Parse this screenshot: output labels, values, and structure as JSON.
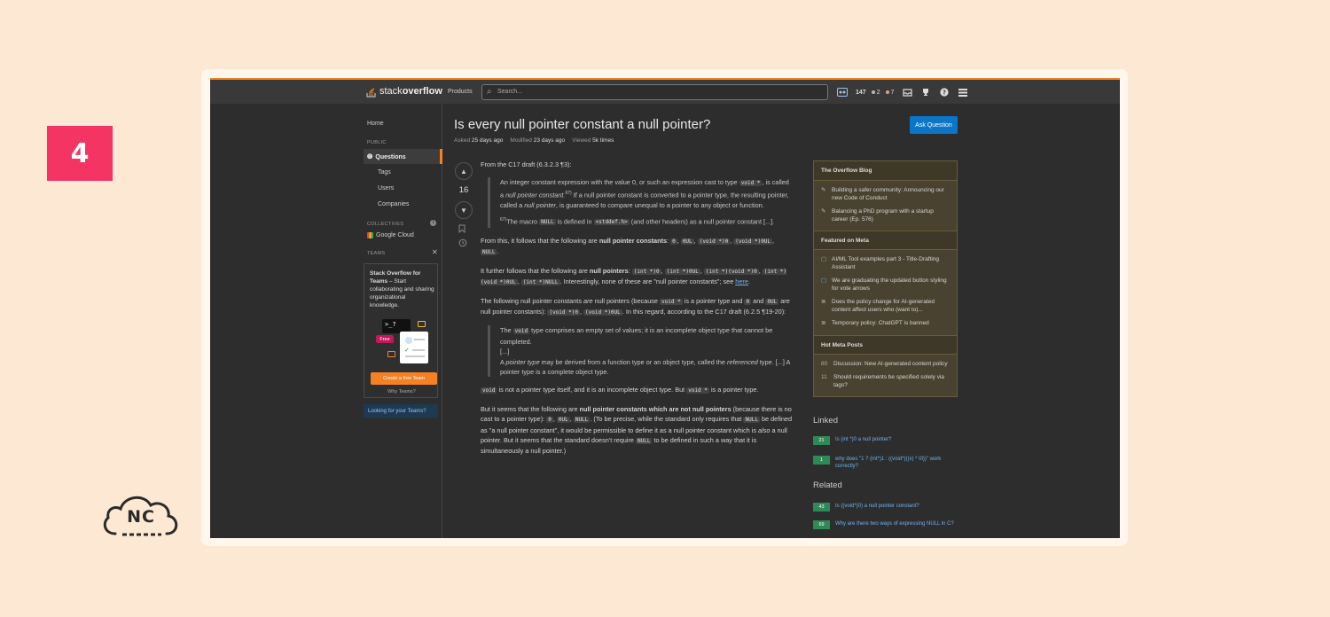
{
  "badge": "4",
  "nc_logo": "NC",
  "topbar": {
    "logo_a": "stack",
    "logo_b": "overflow",
    "products": "Products",
    "search_placeholder": "Search...",
    "rep": "147",
    "silver": "2",
    "bronze": "7"
  },
  "nav": {
    "home": "Home",
    "public": "PUBLIC",
    "questions": "Questions",
    "tags": "Tags",
    "users": "Users",
    "companies": "Companies",
    "collectives": "COLLECTIVES",
    "google_cloud": "Google Cloud",
    "teams": "TEAMS",
    "teams_title": "Stack Overflow for Teams",
    "teams_text": " – Start collaborating and sharing organizational knowledge.",
    "free": "Free",
    "cta": "Create a free Team",
    "why": "Why Teams?",
    "looking": "Looking for your Teams?"
  },
  "question": {
    "title": "Is every null pointer constant a null pointer?",
    "asked_label": "Asked",
    "asked": "25 days ago",
    "modified_label": "Modified",
    "modified": "23 days ago",
    "viewed_label": "Viewed",
    "viewed": "5k times",
    "ask_button": "Ask Question",
    "votes": "16"
  },
  "post": {
    "p1": "From the C17 draft (6.3.2.3 ¶3):",
    "q1a": "An integer constant expression with the value 0, or such an expression cast to type",
    "c_voidstar": "void *",
    "q1b": ", is called a",
    "q1c": "null pointer constant.",
    "q1sup": "67)",
    "q1d": " If a null pointer constant is converted to a pointer type, the resulting pointer, called a",
    "q1e": "null pointer",
    "q1f": ", is guaranteed to compare unequal to a pointer to any object or function.",
    "q2sup": "67)",
    "q2a": "The macro",
    "c_null": "NULL",
    "q2b": "is defined in",
    "c_stddef": "<stddef.h>",
    "q2c": "(and other headers) as a null pointer constant [...].",
    "p2a": "From this, it follows that the following are",
    "p2b": "null pointer constants",
    "c_0": "0",
    "c_0ul": "0UL",
    "c_void0": "(void *)0",
    "c_void0ul": "(void *)0UL",
    "p3a": "It further follows that the following are",
    "p3b": "null pointers",
    "c_int0": "(int *)0",
    "c_int0ul": "(int *)0UL",
    "c_intvoid0": "(int *)(void *)0",
    "c_intvoid0ul": "(int *)(void *)0UL",
    "c_intnull": "(int *)NULL",
    "p3c": ". Interestingly, none of these are \"null pointer constants\"; see",
    "p3link": "here",
    "p4a": "The following null pointer constants",
    "p4are": "are",
    "p4b": "null pointers (because",
    "p4c": "is a pointer type and",
    "p4d": "and",
    "p4e": "are null pointer constants):",
    "p4f": ". In this regard, according to the C17 draft (6.2.5 ¶19-20):",
    "q3a": "The",
    "c_void": "void",
    "q3b": "type comprises an empty set of values; it is an incomplete object type that cannot be completed.",
    "q3dots": "[...]",
    "q3c": "A",
    "q3d": "pointer type",
    "q3e": "may be derived from a function type or an object type, called the",
    "q3f": "referenced",
    "q3g": "type. [...] A pointer type is a complete object type.",
    "p5a": "is not a pointer type itself, and it is an incomplete object type. But",
    "p5b": "is a pointer type.",
    "p6a": "But it seems that the following are",
    "p6b": "null pointer constants which are not null pointers",
    "p6c": "(because there is no cast to a pointer type):",
    "p6d": ". (To be precise, while the standard only requires that",
    "p6e": "be defined as \"a null pointer constant\", it would be permissible to define it as a null pointer constant which is",
    "p6also": "also",
    "p6f": "a null pointer. But it seems that the standard doesn't require",
    "p6g": "to be defined in such a way that it is simultaneously a null pointer.)"
  },
  "sidebar": {
    "blog_title": "The Overflow Blog",
    "blog_items": [
      "Building a safer community: Announcing our new Code of Conduct",
      "Balancing a PhD program with a startup career (Ep. 576)"
    ],
    "meta_title": "Featured on Meta",
    "meta_items": [
      "AI/ML Tool examples part 3 - Title-Drafting Assistant",
      "We are graduating the updated button styling for vote arrows",
      "Does the policy change for AI-generated content affect users who (want to)...",
      "Temporary policy: ChatGPT is banned"
    ],
    "hot_title": "Hot Meta Posts",
    "hot_items": [
      {
        "n": "80",
        "text": "Discussion: New AI-generated content policy"
      },
      {
        "n": "11",
        "text": "Should requirements be specified solely via tags?"
      }
    ],
    "linked_title": "Linked",
    "linked": [
      {
        "score": "21",
        "text": "Is (int *)0 a null pointer?"
      },
      {
        "score": "1",
        "text": "why does \"1 ? (int*)1 : ((void*)((x) * 0l))\" work correctly?"
      }
    ],
    "related_title": "Related",
    "related": [
      {
        "score": "43",
        "text": "Is ((void*)0) a null pointer constant?"
      },
      {
        "score": "69",
        "text": "Why are there two ways of expressing NULL in C?"
      }
    ]
  }
}
